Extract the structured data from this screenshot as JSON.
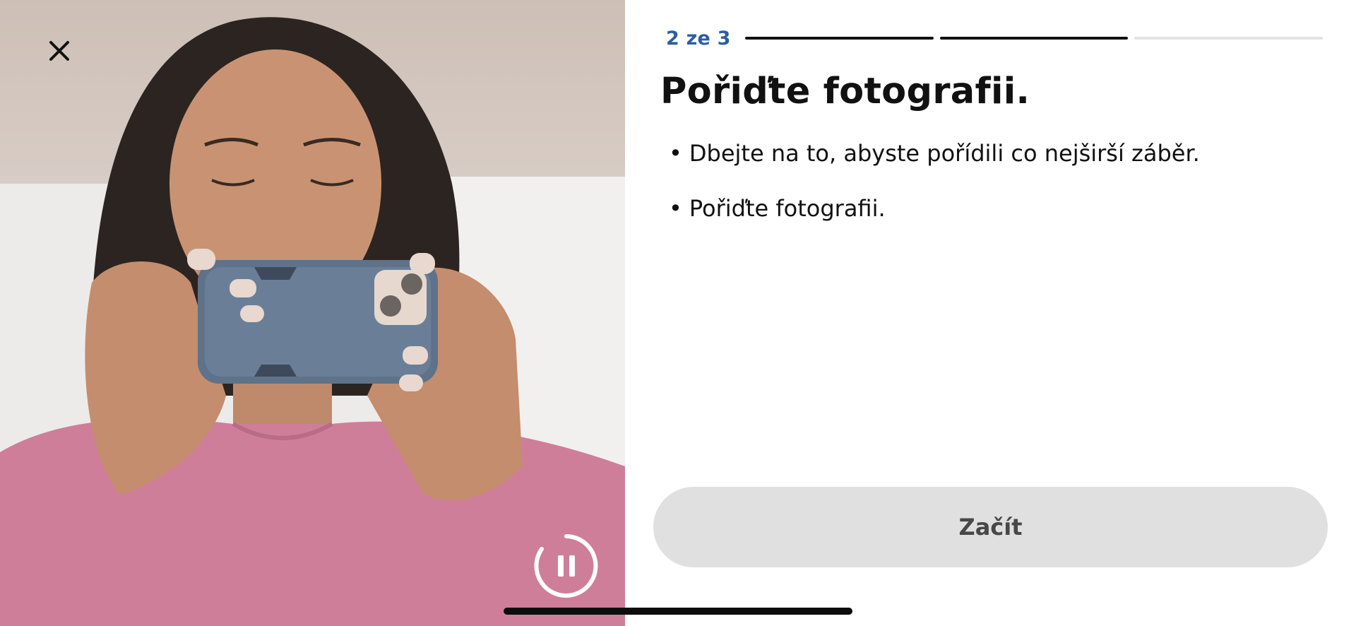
{
  "header": {
    "step_label": "2 ze 3",
    "progress": {
      "current": 2,
      "total": 3
    }
  },
  "main": {
    "title": "Pořiďte fotografii.",
    "bullets": [
      {
        "marker": "•",
        "text": "Dbejte na to, abyste pořídili co nejširší záběr."
      },
      {
        "marker": "•",
        "text": "Pořiďte fotografii."
      }
    ],
    "start_button_label": "Začít"
  },
  "video": {
    "close_icon": "close-icon",
    "pause_icon": "pause-icon"
  },
  "colors": {
    "step_label": "#2a5fa0",
    "progress_done": "#111111",
    "progress_todo": "#e2e2e2",
    "button_bg": "#e0e0e0",
    "button_text": "#484848"
  }
}
